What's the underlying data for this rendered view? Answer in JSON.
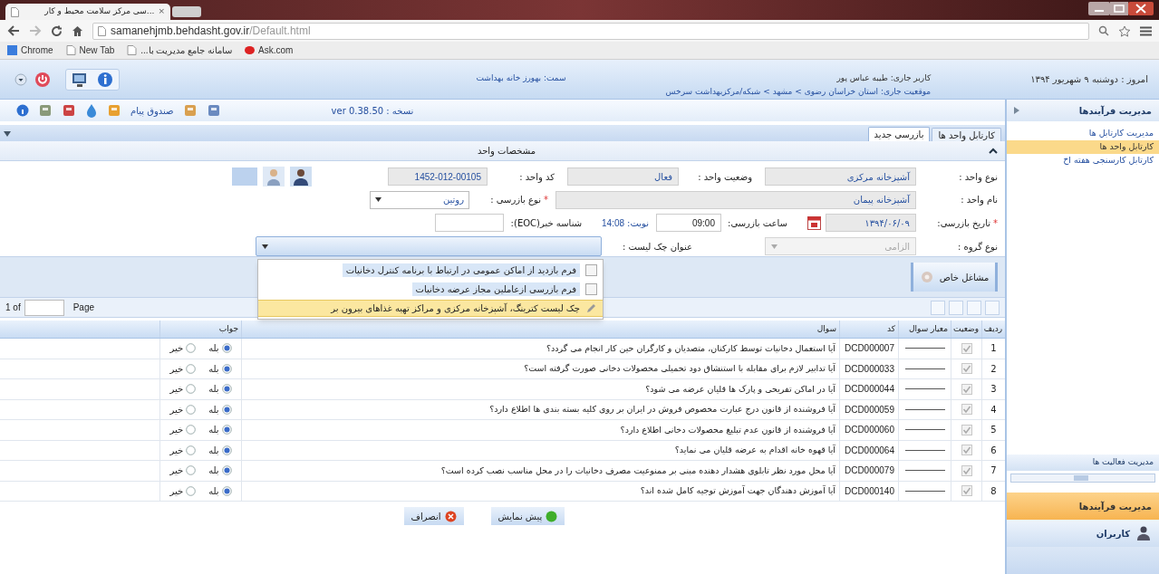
{
  "browser": {
    "tab_title": "...سی مرکز سلامت محیط و کار",
    "close_tab": "×",
    "url_host": "samanehjmb.behdasht.gov.ir",
    "url_path": "/Default.html",
    "bookmarks": {
      "apps": "Chrome",
      "new_tab": "New Tab",
      "portal": "سامانه جامع مدیریت با...",
      "ask": "Ask.com"
    }
  },
  "header": {
    "today": "امروز : دوشنبه ۹ شهریور ۱۳۹۴",
    "user": "کاربر جاری: طیبه عباس پور",
    "location": "موقعیت جاری: استان خراسان رضوی > مشهد > شبکه/مرکزبهداشت سرخس",
    "role": "سمت: بهورز خانه بهداشت"
  },
  "toolbar": {
    "inbox": "صندوق پیام",
    "version": "نسخه : ver 0.38.50"
  },
  "sidebar": {
    "title": "مدیریت فرآیندها",
    "items": [
      {
        "label": "مدیریت کارتابل ها",
        "selected": false
      },
      {
        "label": "کارتابل واحد ها",
        "selected": true
      },
      {
        "label": "کارتابل کارسنجی هفته اخ",
        "selected": false
      }
    ],
    "section": "مدیریت فعالیت ها",
    "panels": [
      {
        "label": "مدیریت فرآیندها",
        "selected": true
      },
      {
        "label": "کاربران",
        "selected": false
      }
    ]
  },
  "tabs": [
    {
      "label": "کارتابل واحد ها",
      "selected": false
    },
    {
      "label": "بازرسی جدید",
      "selected": true
    }
  ],
  "panel_title": "مشخصات واحد",
  "form": {
    "unit_type": {
      "label": "نوع واحد :",
      "value": "آشپزخانه مرکزی"
    },
    "unit_status": {
      "label": "وضعیت واحد :",
      "value": "فعال"
    },
    "unit_code": {
      "label": "کد واحد :",
      "value": "1452-012-00105"
    },
    "unit_name": {
      "label": "نام واحد :",
      "value": "آشپزخانه پیمان"
    },
    "inspection_type": {
      "label": "نوع بازرسی :",
      "value": "روتین",
      "required_mark": "*"
    },
    "inspection_date": {
      "label": "تاریخ بازرسی:",
      "value": "۱۳۹۴/۰۶/۰۹",
      "required_mark": "*"
    },
    "inspection_time": {
      "label": "ساعت بازرسی:",
      "value": "09:00"
    },
    "turn": {
      "label": "نوبت:",
      "value": "14:08"
    },
    "eoc_id": {
      "label": "شناسه خبر(EOC):"
    },
    "group_type": {
      "label": "نوع گروه :",
      "placeholder": "الزامی"
    },
    "checklist": {
      "label": "عنوان چک لیست :",
      "options": [
        {
          "label": "فرم بازدید از اماکن عمومی در ارتباط با برنامه کنترل دخانیات",
          "selected": false
        },
        {
          "label": "فرم بازرسی ازعاملین مجاز عرضه دخانیات",
          "selected": false
        },
        {
          "label": "چک لیست کترینگ، آشپزخانه مرکزی و مراکز تهیه غذاهای بیرون بر",
          "selected": true
        }
      ]
    }
  },
  "special_button": "مشاغل خاص",
  "pager": {
    "of": "1 of",
    "page": "Page"
  },
  "table": {
    "columns": [
      "ردیف",
      "وضعیت",
      "معیار سوال",
      "کد",
      "سوال",
      "جواب"
    ],
    "rows": [
      {
        "number": "1",
        "checked": true,
        "code": "DCD000007",
        "question": "آیا استعمال دخانیات توسط کارکنان، متصدیان و کارگران حین کار انجام می گردد؟",
        "answers": [
          {
            "label": "بله",
            "selected": true
          },
          {
            "label": "خیر",
            "selected": false
          }
        ]
      },
      {
        "number": "2",
        "checked": true,
        "code": "DCD000033",
        "question": "آیا تدابیر لازم برای مقابله با استنشاق دود تحمیلی محصولات دخانی صورت گرفته است؟",
        "answers": [
          {
            "label": "بله",
            "selected": true
          },
          {
            "label": "خیر",
            "selected": false
          }
        ]
      },
      {
        "number": "3",
        "checked": true,
        "code": "DCD000044",
        "question": "آیا در اماکن تفریحی و پارک ها قلیان عرضه می شود؟",
        "answers": [
          {
            "label": "بله",
            "selected": true
          },
          {
            "label": "خیر",
            "selected": false
          }
        ]
      },
      {
        "number": "4",
        "checked": true,
        "code": "DCD000059",
        "question": "آیا فروشنده از قانون درج عبارت مخصوص فروش در ایران بر روی کلیه بسته بندی ها اطلاع دارد؟",
        "answers": [
          {
            "label": "بله",
            "selected": true
          },
          {
            "label": "خیر",
            "selected": false
          }
        ]
      },
      {
        "number": "5",
        "checked": true,
        "code": "DCD000060",
        "question": "آیا فروشنده از قانون عدم تبلیغ محصولات دخانی اطلاع دارد؟",
        "answers": [
          {
            "label": "بله",
            "selected": true
          },
          {
            "label": "خیر",
            "selected": false
          }
        ]
      },
      {
        "number": "6",
        "checked": true,
        "code": "DCD000064",
        "question": "آیا قهوه خانه اقدام به عرضه قلیان می نماید؟",
        "answers": [
          {
            "label": "بله",
            "selected": true
          },
          {
            "label": "خیر",
            "selected": false
          }
        ]
      },
      {
        "number": "7",
        "checked": true,
        "code": "DCD000079",
        "question": "آیا محل مورد نظر تابلوی هشدار دهنده مبنی بر ممنوعیت مصرف دخانیات را در محل مناسب نصب کرده است؟",
        "answers": [
          {
            "label": "بله",
            "selected": true
          },
          {
            "label": "خیر",
            "selected": false
          }
        ]
      },
      {
        "number": "8",
        "checked": true,
        "code": "DCD000140",
        "question": "آیا آموزش دهندگان جهت آموزش توجیه کامل شده اند؟",
        "answers": [
          {
            "label": "بله",
            "selected": true
          },
          {
            "label": "خیر",
            "selected": false
          }
        ]
      }
    ]
  },
  "actions": {
    "preview": "پیش نمایش",
    "cancel": "انصراف"
  }
}
